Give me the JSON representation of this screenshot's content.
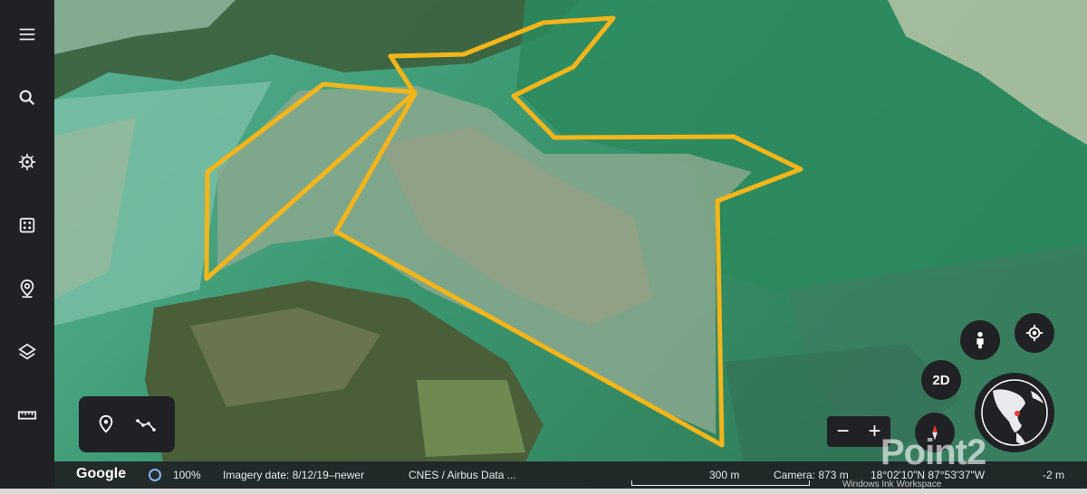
{
  "sidebar": {
    "items": [
      {
        "icon": "menu-icon"
      },
      {
        "icon": "search-icon"
      },
      {
        "icon": "voyager-wheel-icon"
      },
      {
        "icon": "dice-icon"
      },
      {
        "icon": "projects-pin-icon"
      },
      {
        "icon": "layers-icon"
      },
      {
        "icon": "ruler-icon"
      }
    ]
  },
  "draw_tools": {
    "items": [
      {
        "icon": "placemark-icon"
      },
      {
        "icon": "draw-path-icon"
      }
    ]
  },
  "map_controls": {
    "pegman_icon": "pegman-icon",
    "location_icon": "my-location-icon",
    "view_mode_label": "2D",
    "zoom_out_label": "−",
    "zoom_in_label": "+",
    "compass_icon": "compass-icon",
    "globe_icon": "mini-globe-icon"
  },
  "status_bar": {
    "logo": "Google",
    "zoom_percent": "100%",
    "imagery_date": "Imagery date: 8/12/19–newer",
    "attribution": "CNES / Airbus  Data ...",
    "scale_label": "300 m",
    "camera": "Camera: 873 m",
    "coordinates": "18°02'10\"N 87°53'37\"W",
    "altitude": "-2 m"
  },
  "overlays": {
    "watermark": "Point2",
    "windows_watermark": "Windows Ink Workspace"
  },
  "colors": {
    "polygon_stroke": "#f2b51b",
    "panel_bg": "#202124",
    "water_deep": "#2f8a62",
    "water_shallow": "#5fb59a"
  }
}
